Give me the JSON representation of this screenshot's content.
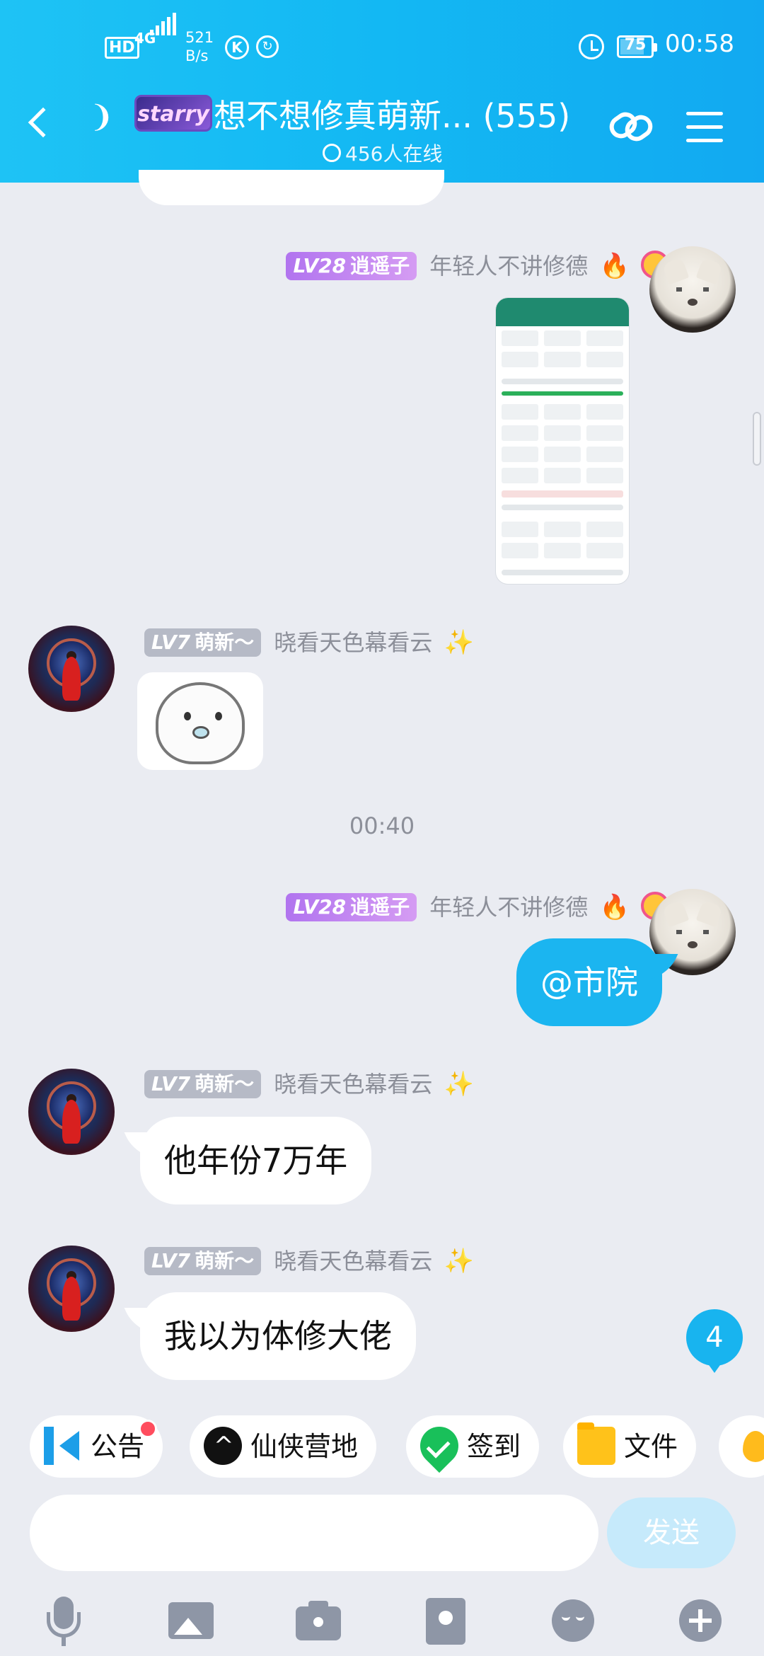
{
  "status_bar": {
    "hd": "HD",
    "network": "4G",
    "speed_value": "521",
    "speed_unit": "B/s",
    "k_icon": "K",
    "battery": "75",
    "time": "00:58"
  },
  "header": {
    "title": "想不想修真萌新... (555)",
    "group_badge": "starry",
    "online_count": "456人在线"
  },
  "messages": [
    {
      "id": "m1",
      "side": "right",
      "level": "LV28",
      "role": "逍遥子",
      "sender": "年轻人不讲修德",
      "type": "image"
    },
    {
      "id": "m2",
      "side": "left",
      "level": "LV7",
      "role": "萌新～",
      "sender": "晓看天色幕看云",
      "type": "sticker"
    },
    {
      "id": "m3",
      "side": "right",
      "level": "LV28",
      "role": "逍遥子",
      "sender": "年轻人不讲修德",
      "text": "@市院"
    },
    {
      "id": "m4",
      "side": "left",
      "level": "LV7",
      "role": "萌新～",
      "sender": "晓看天色幕看云",
      "text": "他年份7万年"
    },
    {
      "id": "m5",
      "side": "left",
      "level": "LV7",
      "role": "萌新～",
      "sender": "晓看天色幕看云",
      "text": "我以为体修大佬"
    }
  ],
  "timestamp": "00:40",
  "unread_count": "4",
  "quick_actions": [
    {
      "label": "公告",
      "icon": "megaphone-icon",
      "has_dot": true
    },
    {
      "label": "仙侠营地",
      "icon": "camp-icon"
    },
    {
      "label": "签到",
      "icon": "checkin-icon"
    },
    {
      "label": "文件",
      "icon": "folder-icon"
    }
  ],
  "input": {
    "placeholder": "",
    "send_label": "发送"
  },
  "toolbar": [
    "mic-icon",
    "image-icon",
    "camera-icon",
    "red-packet-icon",
    "emoji-icon",
    "plus-icon"
  ],
  "colors": {
    "header_start": "#1ec3f5",
    "header_end": "#12a9f1",
    "outgoing_bubble": "#1bb5f0",
    "background": "#eaecf2",
    "level_purple": "#b174ef",
    "level_gray": "#b6bac6"
  }
}
